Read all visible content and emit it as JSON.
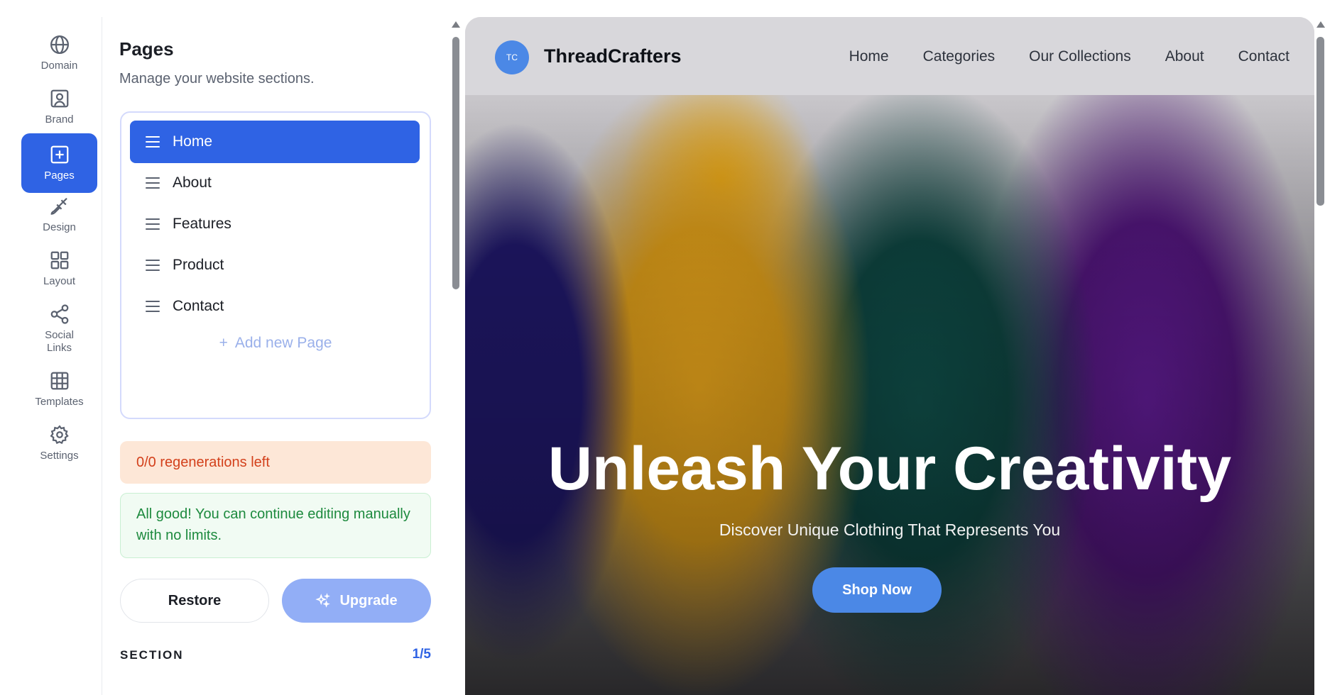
{
  "rail": {
    "items": [
      {
        "label": "Domain",
        "icon": "globe-icon"
      },
      {
        "label": "Brand",
        "icon": "brand-icon"
      },
      {
        "label": "Pages",
        "icon": "plus-square-icon",
        "active": true
      },
      {
        "label": "Design",
        "icon": "brush-icon"
      },
      {
        "label": "Layout",
        "icon": "grid-icon"
      },
      {
        "label": "Social\nLinks",
        "label_line1": "Social",
        "label_line2": "Links",
        "icon": "share-icon"
      },
      {
        "label": "Templates",
        "icon": "table-icon"
      },
      {
        "label": "Settings",
        "icon": "gear-icon"
      }
    ]
  },
  "panel": {
    "title": "Pages",
    "subtitle": "Manage your website sections.",
    "pages": [
      {
        "label": "Home",
        "active": true
      },
      {
        "label": "About"
      },
      {
        "label": "Features"
      },
      {
        "label": "Product"
      },
      {
        "label": "Contact"
      }
    ],
    "add_page_label": "Add new Page",
    "regen_text": "0/0 regenerations left",
    "allgood_text": "All good! You can continue editing manually with no limits.",
    "restore_label": "Restore",
    "upgrade_label": "Upgrade",
    "section_label": "SECTION",
    "section_count": "1/5"
  },
  "preview": {
    "logo_initials": "TC",
    "site_name": "ThreadCrafters",
    "nav_links": [
      "Home",
      "Categories",
      "Our Collections",
      "About",
      "Contact"
    ],
    "hero_title": "Unleash Your Creativity",
    "hero_subtitle": "Discover Unique Clothing That Represents You",
    "cta_label": "Shop Now"
  },
  "colors": {
    "accent": "#2f63e4",
    "site_accent": "#4b88e6",
    "regen_bg": "#fde7d7",
    "regen_text": "#d3401b",
    "allgood_bg": "#f1fbf3",
    "allgood_text": "#1d8a3e",
    "upgrade_bg": "#92aef6"
  }
}
